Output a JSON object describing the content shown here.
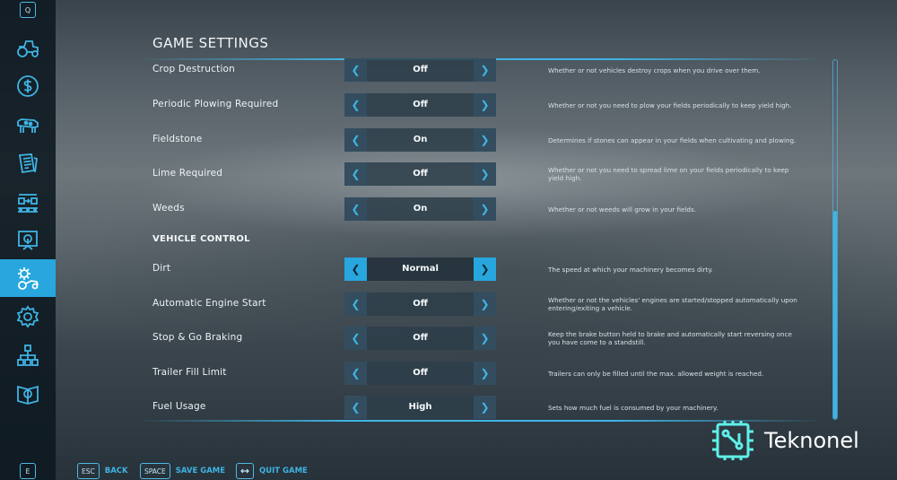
{
  "page": {
    "title": "GAME SETTINGS",
    "section_vehicle": "VEHICLE CONTROL"
  },
  "sidebar": {
    "top_key": "Q",
    "bottom_key": "E",
    "items": [
      {
        "icon": "tractor-icon"
      },
      {
        "icon": "dollar-icon"
      },
      {
        "icon": "cow-icon"
      },
      {
        "icon": "contracts-icon"
      },
      {
        "icon": "production-icon"
      },
      {
        "icon": "map-icon"
      },
      {
        "icon": "game-settings-icon",
        "active": true
      },
      {
        "icon": "gear-icon"
      },
      {
        "icon": "hierarchy-icon"
      },
      {
        "icon": "help-book-icon"
      }
    ]
  },
  "settings": [
    {
      "label": "Crop Destruction",
      "value": "Off",
      "desc": "Whether or not vehicles destroy crops when you drive over them."
    },
    {
      "label": "Periodic Plowing Required",
      "value": "Off",
      "desc": "Whether or not you need to plow your fields periodically to keep yield high."
    },
    {
      "label": "Fieldstone",
      "value": "On",
      "desc": "Determines if stones can appear in your fields when cultivating and plowing."
    },
    {
      "label": "Lime Required",
      "value": "Off",
      "desc": "Whether or not you need to spread lime on your fields periodically to keep yield high."
    },
    {
      "label": "Weeds",
      "value": "On",
      "desc": "Whether or not weeds will grow in your fields."
    },
    {
      "label": "Dirt",
      "value": "Normal",
      "desc": "The speed at which your machinery becomes dirty."
    },
    {
      "label": "Automatic Engine Start",
      "value": "Off",
      "desc": "Whether or not the vehicles' engines are started/stopped automatically upon entering/exiting a vehicle."
    },
    {
      "label": "Stop & Go Braking",
      "value": "Off",
      "desc": "Keep the brake button held to brake and automatically start reversing once you have come to a standstill."
    },
    {
      "label": "Trailer Fill Limit",
      "value": "Off",
      "desc": "Trailers can only be filled until the max. allowed weight is reached."
    },
    {
      "label": "Fuel Usage",
      "value": "High",
      "desc": "Sets how much fuel is consumed by your machinery."
    }
  ],
  "footer": {
    "back_key": "ESC",
    "back_label": "BACK",
    "save_key": "SPACE",
    "save_label": "SAVE GAME",
    "quit_label": "QUIT GAME"
  },
  "watermark": {
    "name": "Teknonel"
  },
  "colors": {
    "accent": "#27a7dd",
    "sidebar": "#0c1820"
  }
}
